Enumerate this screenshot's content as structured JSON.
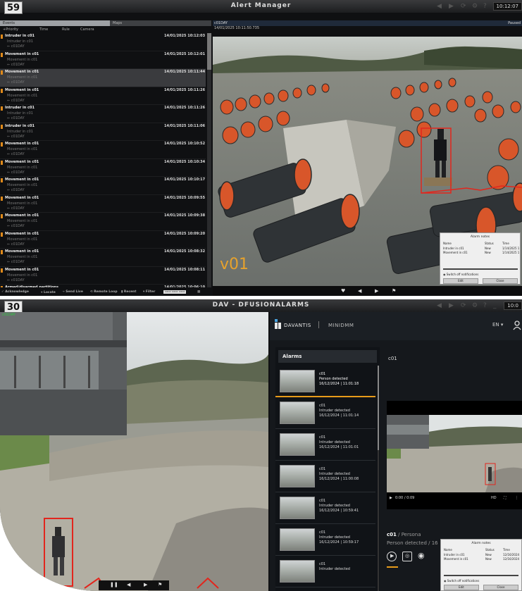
{
  "window1": {
    "badge": "59",
    "title": "Alert Manager",
    "clock": "10:12:07",
    "tabs": {
      "events": "Events",
      "maps": "Maps"
    },
    "sort_headers": [
      "+Priority",
      "Time",
      "Rule",
      "Camera"
    ],
    "events": [
      {
        "title": "Intruder in c01",
        "desc": "Intruder in c01",
        "cam": "c01DAY",
        "time": "14/01/2025 10:12:03",
        "selected": false
      },
      {
        "title": "Movement in c01",
        "desc": "Movement in c01",
        "cam": "c01DAY",
        "time": "14/01/2025 10:12:01",
        "selected": false
      },
      {
        "title": "Movement in c01",
        "desc": "Movement in c01",
        "cam": "c01DAY",
        "time": "14/01/2025 10:11:44",
        "selected": true
      },
      {
        "title": "Movement in c01",
        "desc": "Movement in c01",
        "cam": "c01DAY",
        "time": "14/01/2025 10:11:26",
        "selected": false
      },
      {
        "title": "Intruder in c01",
        "desc": "Intruder in c01",
        "cam": "c01DAY",
        "time": "14/01/2025 10:11:26",
        "selected": false
      },
      {
        "title": "Intruder in c01",
        "desc": "Intruder in c01",
        "cam": "c01DAY",
        "time": "14/01/2025 10:11:06",
        "selected": false
      },
      {
        "title": "Movement in c01",
        "desc": "Movement in c01",
        "cam": "c01DAY",
        "time": "14/01/2025 10:10:52",
        "selected": false
      },
      {
        "title": "Movement in c01",
        "desc": "Movement in c01",
        "cam": "c01DAY",
        "time": "14/01/2025 10:10:34",
        "selected": false
      },
      {
        "title": "Movement in c01",
        "desc": "Movement in c01",
        "cam": "c01DAY",
        "time": "14/01/2025 10:10:17",
        "selected": false
      },
      {
        "title": "Movement in c01",
        "desc": "Movement in c01",
        "cam": "c01DAY",
        "time": "14/01/2025 10:09:55",
        "selected": false
      },
      {
        "title": "Movement in c01",
        "desc": "Movement in c01",
        "cam": "c01DAY",
        "time": "14/01/2025 10:09:38",
        "selected": false
      },
      {
        "title": "Movement in c01",
        "desc": "Movement in c01",
        "cam": "c01DAY",
        "time": "14/01/2025 10:09:20",
        "selected": false
      },
      {
        "title": "Movement in c01",
        "desc": "Movement in c01",
        "cam": "c01DAY",
        "time": "14/01/2025 10:08:32",
        "selected": false
      },
      {
        "title": "Movement in c01",
        "desc": "Movement in c01",
        "cam": "c01DAY",
        "time": "14/01/2025 10:08:11",
        "selected": false
      },
      {
        "title": "Armed/disarmed partitions",
        "desc": "",
        "cam": "",
        "time": "14/01/2025 10:06:10",
        "selected": false
      }
    ],
    "bottom_toolbar": [
      "Acknowledge",
      "Locate",
      "Send Live",
      "Remote Loop",
      "Recent",
      "Filter"
    ],
    "camera_name": "c01DAY",
    "camera_status": "Paused",
    "camera_timestamp": "14/01/2025 10:11:50.735",
    "overlay_label": "v01",
    "notes": {
      "title": "Alarm notes",
      "columns": [
        "Name",
        "Status",
        "Time"
      ],
      "rows": [
        {
          "name": "Intruder in c01",
          "status": "New",
          "time": "1/14/2025 1"
        },
        {
          "name": "Movement in c01",
          "status": "New",
          "time": "1/14/2025 1"
        }
      ],
      "switch_label": "Switch off notifications",
      "edit": "Edit",
      "close": "Close"
    },
    "accent": "#e08a1a"
  },
  "window2": {
    "badge": "30",
    "title": "DAV - DFUSIONALARMS",
    "clock": "10:0",
    "cam_label": "c01DAY",
    "logo": "DAVANTIS",
    "product": "MINIDMM",
    "lang": "EN",
    "alarms_title": "Alarms",
    "alarms": [
      {
        "camera": "c01",
        "type": "Person detected",
        "date": "16/12/2024 | 11:01:18",
        "selected": true
      },
      {
        "camera": "c01",
        "type": "Intruder detected",
        "date": "16/12/2024 | 11:01:14",
        "selected": false
      },
      {
        "camera": "c01",
        "type": "Intruder detected",
        "date": "16/12/2024 | 11:01:01",
        "selected": false
      },
      {
        "camera": "c01",
        "type": "Intruder detected",
        "date": "16/12/2024 | 11:00:08",
        "selected": false
      },
      {
        "camera": "c01",
        "type": "Intruder detected",
        "date": "16/12/2024 | 10:59:41",
        "selected": false
      },
      {
        "camera": "c01",
        "type": "Intruder detected",
        "date": "16/12/2024 | 10:59:17",
        "selected": false
      },
      {
        "camera": "c01",
        "type": "Intruder detected",
        "date": "",
        "selected": false
      }
    ],
    "detail_title": "c01",
    "video_time": "0:00 / 0:09",
    "info_camera": "c01",
    "info_category": "/ Persona",
    "info_line2": "Person detected / 16",
    "notes": {
      "title": "Alarm notes",
      "columns": [
        "Name",
        "Status",
        "Time"
      ],
      "rows": [
        {
          "name": "Intruder in c01",
          "status": "New",
          "time": "12/16/2024"
        },
        {
          "name": "Movement in c01",
          "status": "New",
          "time": "12/16/2024"
        }
      ],
      "switch_label": "Switch off notifications",
      "edit": "Edit",
      "close": "Close"
    },
    "accent": "#e79b1a"
  }
}
